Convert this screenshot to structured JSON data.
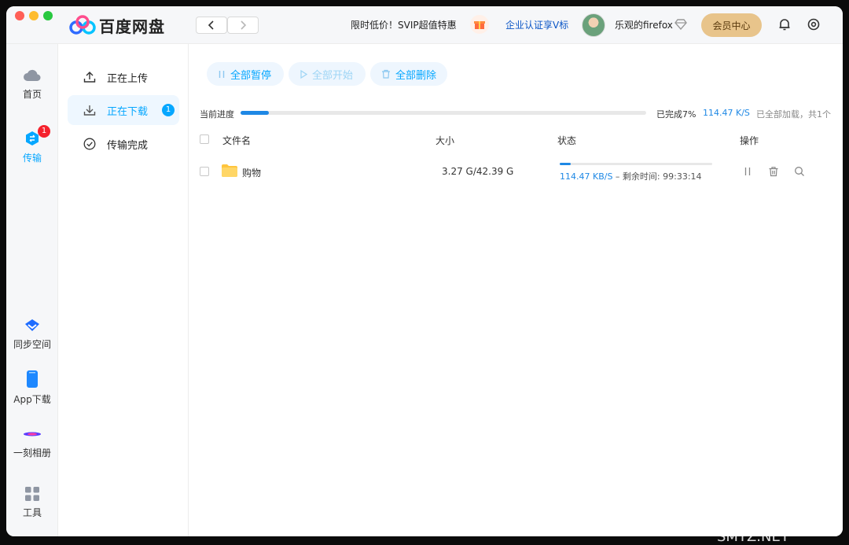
{
  "header": {
    "app_name": "百度网盘",
    "promo": "限时低价！SVIP超值特惠",
    "enterprise": "企业认证享V标",
    "username": "乐观的firefox",
    "vip_button": "会员中心"
  },
  "rail": {
    "items": [
      {
        "label": "首页",
        "icon": "cloud-icon"
      },
      {
        "label": "传输",
        "icon": "transfer-icon",
        "badge": "1",
        "active": true
      },
      {
        "label": "同步空间",
        "icon": "sync-icon"
      },
      {
        "label": "App下载",
        "icon": "phone-icon"
      },
      {
        "label": "一刻相册",
        "icon": "album-icon"
      },
      {
        "label": "工具",
        "icon": "tools-icon"
      }
    ]
  },
  "sidebar": {
    "items": [
      {
        "label": "正在上传",
        "icon": "upload-icon"
      },
      {
        "label": "正在下载",
        "icon": "download-icon",
        "badge": "1",
        "active": true
      },
      {
        "label": "传输完成",
        "icon": "check-circle-icon"
      }
    ]
  },
  "toolbar": {
    "pause_all": "全部暂停",
    "start_all": "全部开始",
    "delete_all": "全部删除"
  },
  "progress": {
    "label": "当前进度",
    "fraction": 0.07,
    "done": "已完成7%",
    "speed": "114.47 K/S",
    "summary": "已全部加载，共1个"
  },
  "table": {
    "headers": {
      "name": "文件名",
      "size": "大小",
      "status": "状态",
      "actions": "操作"
    },
    "rows": [
      {
        "name": "购物",
        "size": "3.27 G/42.39 G",
        "progress_fraction": 0.07,
        "speed": "114.47 KB/S",
        "remaining": " – 剩余时间: 99:33:14"
      }
    ]
  },
  "colors": {
    "accent": "#06a7ff",
    "progress": "#1e88e5",
    "vip": "#e8c48b"
  },
  "watermark": "值 什么值得买 SMYZ.NET"
}
